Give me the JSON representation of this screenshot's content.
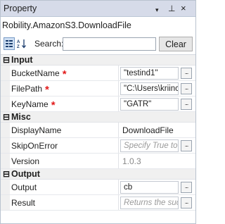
{
  "panel": {
    "title": "Property",
    "dropdown_icon": "▾",
    "pin_icon": "⊥",
    "close_icon": "×",
    "type_name": "Robility.AmazonS3.DownloadFile"
  },
  "toolbar": {
    "categorized_icon": "categorized-sort-icon",
    "alpha_icon": "alphabetical-sort-icon",
    "alpha_glyph": "A↓",
    "search_label": "Search:",
    "search_value": "",
    "clear_label": "Clear"
  },
  "categories": [
    {
      "label": "Input",
      "toggle": "⊟",
      "properties": [
        {
          "name": "BucketName",
          "required": true,
          "value": "\"testind1\"",
          "placeholder": false
        },
        {
          "name": "FilePath",
          "required": true,
          "value": "\"C:\\Users\\kriinc",
          "placeholder": false
        },
        {
          "name": "KeyName",
          "required": true,
          "value": "\"GATR\"",
          "placeholder": false
        }
      ]
    },
    {
      "label": "Misc",
      "toggle": "⊟",
      "properties": [
        {
          "name": "DisplayName",
          "value": "DownloadFile"
        },
        {
          "name": "SkipOnError",
          "value": "Specify True to",
          "placeholder": true
        },
        {
          "name": "Version",
          "value": "1.0.3"
        }
      ]
    },
    {
      "label": "Output",
      "toggle": "⊟",
      "properties": [
        {
          "name": "Output",
          "value": "cb",
          "placeholder": false
        },
        {
          "name": "Result",
          "value": "Returns the suc",
          "placeholder": true
        }
      ]
    }
  ],
  "required_marker": "*",
  "ellipsis": "..."
}
